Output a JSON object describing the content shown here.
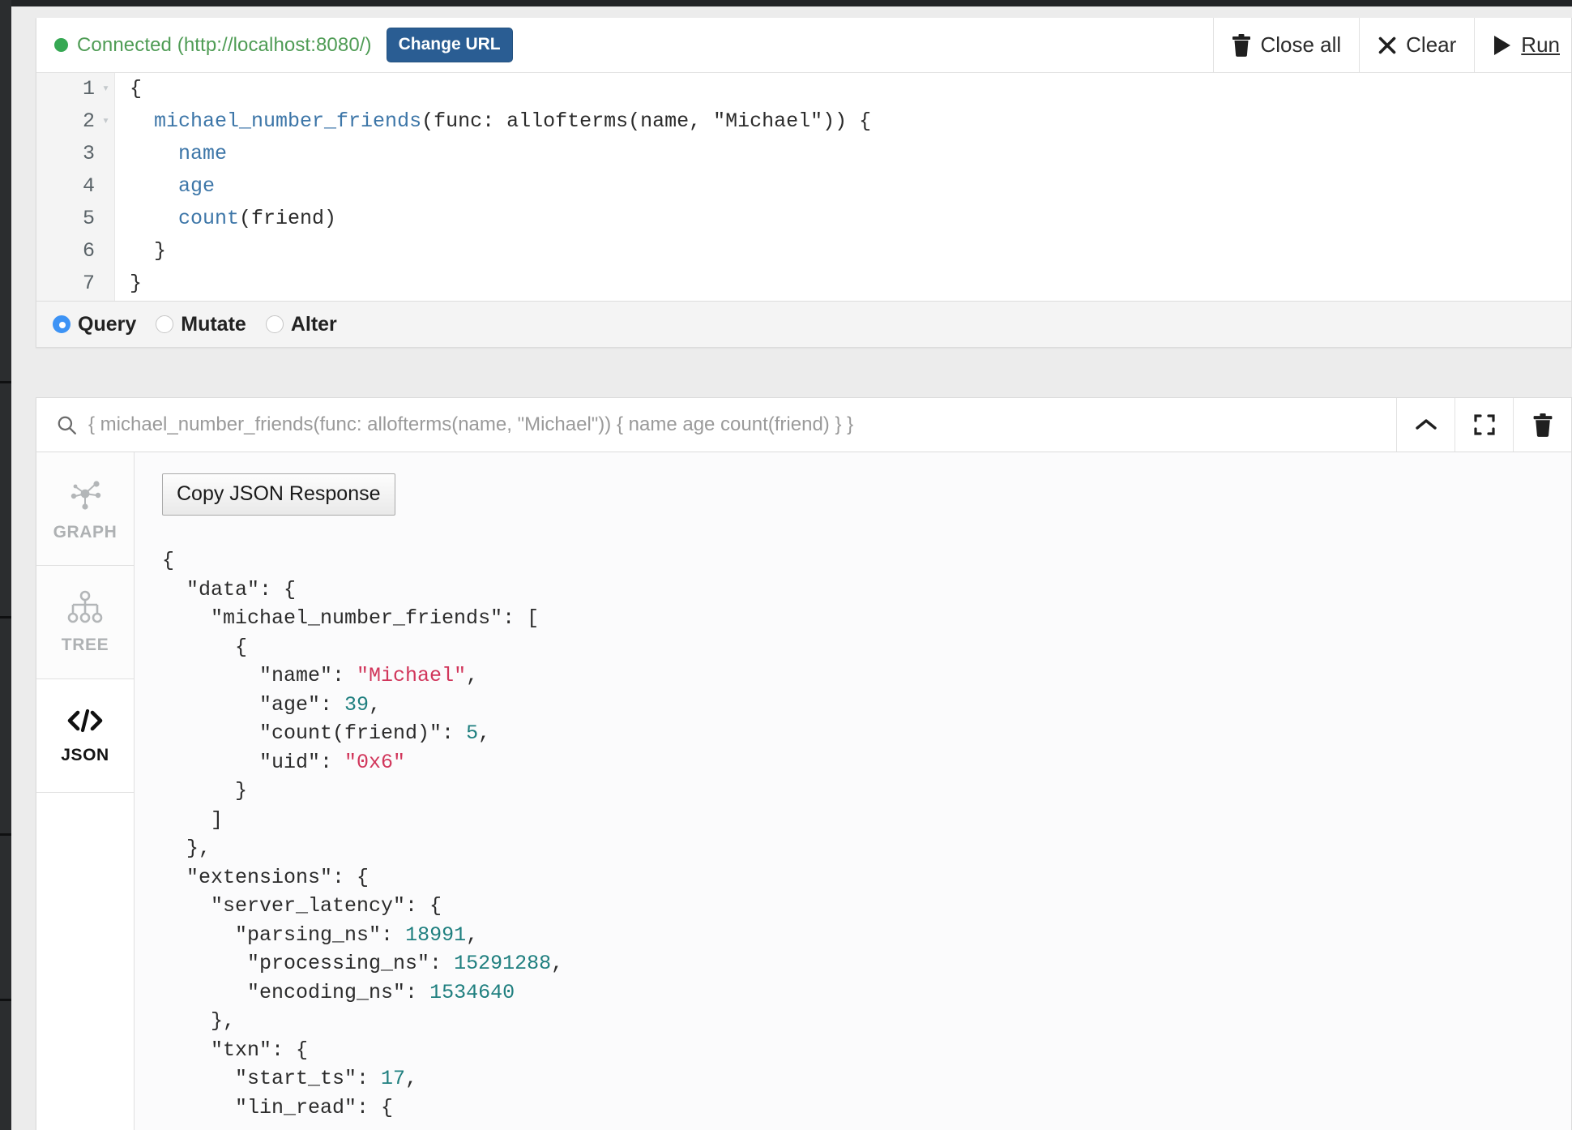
{
  "colors": {
    "accent_blue": "#2a5d93",
    "connected_green": "#4f9c55",
    "radio_selected": "#3d93f5",
    "json_string": "#d1365b",
    "json_number": "#1f7f7f",
    "code_keyword": "#3d76a8"
  },
  "connection": {
    "status_text": "Connected (http://localhost:8080/)",
    "status_dot": "green-dot-icon",
    "change_url_label": "Change URL"
  },
  "toolbar": {
    "close_all_label": "Close all",
    "close_all_icon": "trash-icon",
    "clear_label": "Clear",
    "clear_icon": "close-x-icon",
    "run_label": "Run",
    "run_icon": "play-icon"
  },
  "editor": {
    "lines": [
      {
        "number": "1",
        "fold": "▾",
        "segments": [
          {
            "t": "{",
            "c": "plain"
          }
        ]
      },
      {
        "number": "2",
        "fold": "▾",
        "segments": [
          {
            "t": "  ",
            "c": "plain"
          },
          {
            "t": "michael_number_friends",
            "c": "fn"
          },
          {
            "t": "(func: allofterms(name, \"Michael\")) {",
            "c": "plain"
          }
        ]
      },
      {
        "number": "3",
        "fold": "",
        "segments": [
          {
            "t": "    ",
            "c": "plain"
          },
          {
            "t": "name",
            "c": "pred"
          }
        ]
      },
      {
        "number": "4",
        "fold": "",
        "segments": [
          {
            "t": "    ",
            "c": "plain"
          },
          {
            "t": "age",
            "c": "pred"
          }
        ]
      },
      {
        "number": "5",
        "fold": "",
        "segments": [
          {
            "t": "    ",
            "c": "plain"
          },
          {
            "t": "count",
            "c": "pred"
          },
          {
            "t": "(friend)",
            "c": "plain"
          }
        ]
      },
      {
        "number": "6",
        "fold": "",
        "segments": [
          {
            "t": "  }",
            "c": "plain"
          }
        ]
      },
      {
        "number": "7",
        "fold": "",
        "segments": [
          {
            "t": "}",
            "c": "plain"
          }
        ]
      }
    ]
  },
  "mode": {
    "options": [
      {
        "label": "Query",
        "selected": true
      },
      {
        "label": "Mutate",
        "selected": false
      },
      {
        "label": "Alter",
        "selected": false
      }
    ]
  },
  "result": {
    "query_text": "{ michael_number_friends(func: allofterms(name, \"Michael\")) { name age count(friend) } }",
    "search_icon": "search-icon",
    "head_buttons": [
      {
        "name": "collapse-button",
        "icon": "chevron-up-icon"
      },
      {
        "name": "fullscreen-button",
        "icon": "fullscreen-icon"
      },
      {
        "name": "delete-result-button",
        "icon": "trash-icon"
      }
    ],
    "view_tabs": [
      {
        "label": "GRAPH",
        "icon": "graph-nodes-icon",
        "active": false
      },
      {
        "label": "TREE",
        "icon": "tree-hierarchy-icon",
        "active": false
      },
      {
        "label": "JSON",
        "icon": "code-brackets-icon",
        "active": true
      }
    ],
    "copy_json_label": "Copy JSON Response",
    "json_lines": [
      [
        {
          "t": "{",
          "c": "p"
        }
      ],
      [
        {
          "t": "  \"data\": {",
          "c": "p"
        }
      ],
      [
        {
          "t": "    \"michael_number_friends\": [",
          "c": "p"
        }
      ],
      [
        {
          "t": "      {",
          "c": "p"
        }
      ],
      [
        {
          "t": "        \"name\": ",
          "c": "p"
        },
        {
          "t": "\"Michael\"",
          "c": "s"
        },
        {
          "t": ",",
          "c": "p"
        }
      ],
      [
        {
          "t": "        \"age\": ",
          "c": "p"
        },
        {
          "t": "39",
          "c": "n"
        },
        {
          "t": ",",
          "c": "p"
        }
      ],
      [
        {
          "t": "        \"count(friend)\": ",
          "c": "p"
        },
        {
          "t": "5",
          "c": "n"
        },
        {
          "t": ",",
          "c": "p"
        }
      ],
      [
        {
          "t": "        \"uid\": ",
          "c": "p"
        },
        {
          "t": "\"0x6\"",
          "c": "s"
        }
      ],
      [
        {
          "t": "      }",
          "c": "p"
        }
      ],
      [
        {
          "t": "    ]",
          "c": "p"
        }
      ],
      [
        {
          "t": "  },",
          "c": "p"
        }
      ],
      [
        {
          "t": "  \"extensions\": {",
          "c": "p"
        }
      ],
      [
        {
          "t": "    \"server_latency\": {",
          "c": "p"
        }
      ],
      [
        {
          "t": "      \"parsing_ns\": ",
          "c": "p"
        },
        {
          "t": "18991",
          "c": "n"
        },
        {
          "t": ",",
          "c": "p"
        }
      ],
      [
        {
          "t": "       \"processing_ns\": ",
          "c": "p"
        },
        {
          "t": "15291288",
          "c": "n"
        },
        {
          "t": ",",
          "c": "p"
        }
      ],
      [
        {
          "t": "       \"encoding_ns\": ",
          "c": "p"
        },
        {
          "t": "1534640",
          "c": "n"
        }
      ],
      [
        {
          "t": "    },",
          "c": "p"
        }
      ],
      [
        {
          "t": "    \"txn\": {",
          "c": "p"
        }
      ],
      [
        {
          "t": "      \"start_ts\": ",
          "c": "p"
        },
        {
          "t": "17",
          "c": "n"
        },
        {
          "t": ",",
          "c": "p"
        }
      ],
      [
        {
          "t": "      \"lin_read\": {",
          "c": "p"
        }
      ]
    ]
  }
}
